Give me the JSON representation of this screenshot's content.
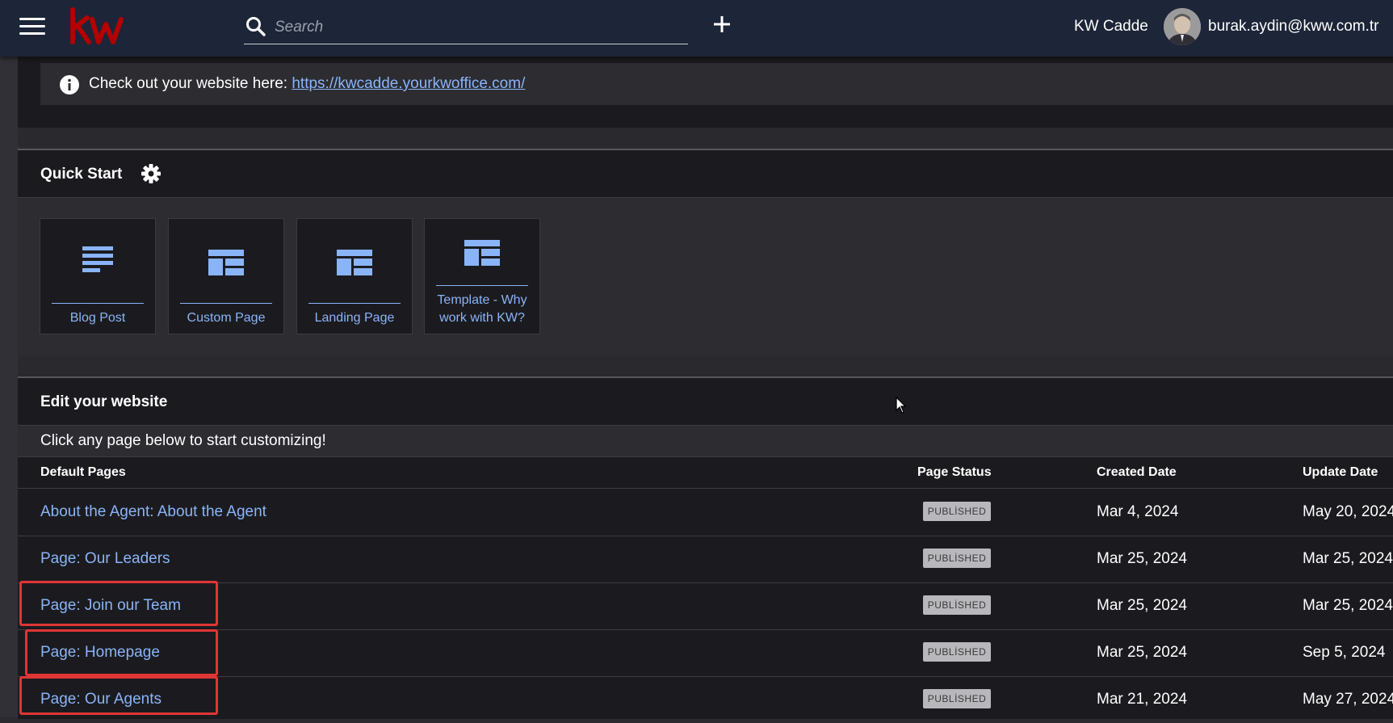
{
  "header": {
    "search_placeholder": "Search",
    "office_name": "KW Cadde",
    "user_email": "burak.aydin@kww.com.tr"
  },
  "info": {
    "text": "Check out your website here: ",
    "link": "https://kwcadde.yourkwoffice.com/"
  },
  "quick_start": {
    "title": "Quick Start",
    "tiles": [
      {
        "label": "Blog Post",
        "icon": "blog-post-icon"
      },
      {
        "label": "Custom Page",
        "icon": "custom-page-icon"
      },
      {
        "label": "Landing Page",
        "icon": "landing-page-icon"
      },
      {
        "label": "Template - Why work with KW?",
        "icon": "template-icon"
      }
    ]
  },
  "edit_site": {
    "title": "Edit your website",
    "subtitle": "Click any page below to start customizing!",
    "columns": [
      "Default Pages",
      "Page Status",
      "Created Date",
      "Update Date"
    ],
    "rows": [
      {
        "name": "About the Agent: About the Agent",
        "status": "PUBLİSHED",
        "created": "Mar 4, 2024",
        "updated": "May 20, 2024"
      },
      {
        "name": "Page: Our Leaders",
        "status": "PUBLİSHED",
        "created": "Mar 25, 2024",
        "updated": "Mar 25, 2024"
      },
      {
        "name": "Page: Join our Team",
        "status": "PUBLİSHED",
        "created": "Mar 25, 2024",
        "updated": "Mar 25, 2024"
      },
      {
        "name": "Page: Homepage",
        "status": "PUBLİSHED",
        "created": "Mar 25, 2024",
        "updated": "Sep 5, 2024"
      },
      {
        "name": "Page: Our Agents",
        "status": "PUBLİSHED",
        "created": "Mar 21, 2024",
        "updated": "May 27, 2024"
      }
    ]
  },
  "colors": {
    "topbar": "#1d2538",
    "accent_link": "#8ab4f8",
    "brand_red": "#b40101",
    "highlight": "#e03535"
  }
}
